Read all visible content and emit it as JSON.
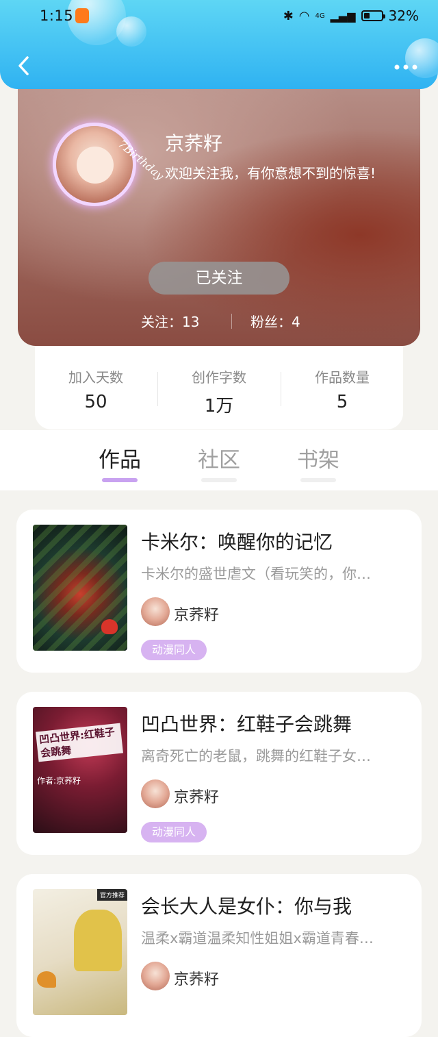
{
  "status_bar": {
    "time": "1:15",
    "network": "4G",
    "battery_percent": "32%"
  },
  "nav": {
    "back_icon": "chevron-left-icon",
    "more_icon": "more-dots-icon"
  },
  "profile": {
    "name": "京荞籽",
    "bio": "欢迎关注我，有你意想不到的惊喜!",
    "avatar_text": "7Birthday",
    "follow_button": "已关注",
    "following_label": "关注：",
    "following_count": "13",
    "fans_label": "粉丝：",
    "fans_count": "4"
  },
  "stats": [
    {
      "label": "加入天数",
      "value": "50"
    },
    {
      "label": "创作字数",
      "value": "1万"
    },
    {
      "label": "作品数量",
      "value": "5"
    }
  ],
  "tabs": [
    {
      "label": "作品",
      "active": true
    },
    {
      "label": "社区",
      "active": false
    },
    {
      "label": "书架",
      "active": false
    }
  ],
  "books": [
    {
      "title": "卡米尔：唤醒你的记忆",
      "description": "卡米尔的盛世虐文（看玩笑的，你…",
      "author": "京荞籽",
      "tag": "动漫同人"
    },
    {
      "title": "凹凸世界：红鞋子会跳舞",
      "description": "离奇死亡的老鼠，跳舞的红鞋子女…",
      "author": "京荞籽",
      "tag": "动漫同人",
      "cover_text": "凹凸世界:红鞋子会跳舞",
      "cover_author": "作者:京荞籽"
    },
    {
      "title": "会长大人是女仆：你与我",
      "description": "温柔x霸道温柔知性姐姐x霸道青春…",
      "author": "京荞籽",
      "cover_badge": "官方推荐"
    }
  ]
}
